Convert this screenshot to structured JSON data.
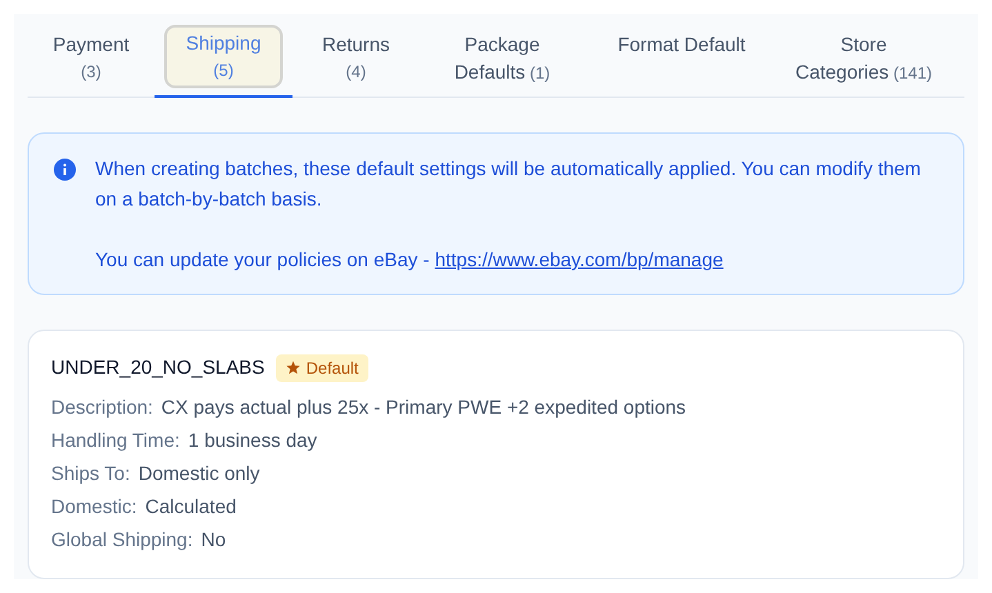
{
  "tabs": [
    {
      "label": "Payment",
      "count": "(3)",
      "kind": "stacked",
      "selected": false
    },
    {
      "label": "Shipping",
      "count": "(5)",
      "kind": "stacked",
      "selected": true
    },
    {
      "label": "Returns",
      "count": "(4)",
      "kind": "stacked",
      "selected": false
    },
    {
      "label": "Package Defaults",
      "count": "(1)",
      "kind": "inline",
      "selected": false
    },
    {
      "label": "Format Default",
      "kind": "inline",
      "selected": false
    },
    {
      "label": "Store Categories",
      "count": "(141)",
      "kind": "inline",
      "selected": false
    }
  ],
  "info": {
    "message": "When creating batches, these default settings will be automatically applied. You can modify them on a batch-by-batch basis.",
    "update_text": "You can update your policies on eBay -",
    "link": "https://www.ebay.com/bp/manage"
  },
  "policy": {
    "name": "UNDER_20_NO_SLABS",
    "badge": "Default",
    "fields": [
      {
        "label": "Description:",
        "value": "CX pays actual plus 25x - Primary PWE +2 expedited options"
      },
      {
        "label": "Handling Time:",
        "value": "1 business day"
      },
      {
        "label": "Ships To:",
        "value": "Domestic only"
      },
      {
        "label": "Domestic:",
        "value": "Calculated"
      },
      {
        "label": "Global Shipping:",
        "value": "No"
      }
    ]
  }
}
